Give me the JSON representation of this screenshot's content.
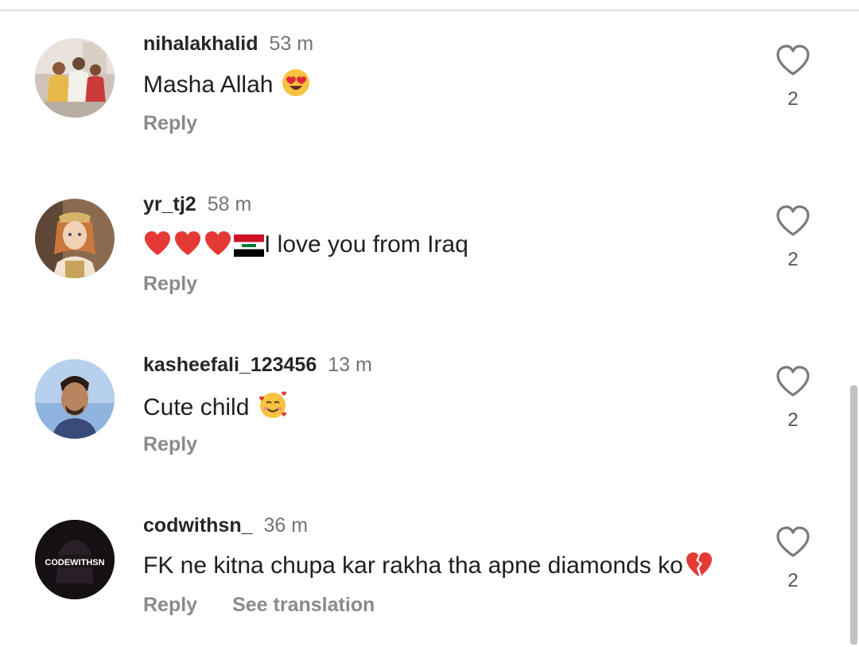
{
  "comments": [
    {
      "username": "nihalakhalid",
      "time": "53 m",
      "text": "Masha Allah ",
      "emoji": [
        "heart-eyes"
      ],
      "reply_label": "Reply",
      "likes": "2",
      "avatar": "family-photo"
    },
    {
      "username": "yr_tj2",
      "time": "58 m",
      "text_prefix_emoji": [
        "red-heart",
        "red-heart",
        "red-heart",
        "iraq-flag"
      ],
      "text": "I love you from Iraq",
      "reply_label": "Reply",
      "likes": "2",
      "avatar": "anime-girl"
    },
    {
      "username": "kasheefali_123456",
      "time": "13 m",
      "text": "Cute child ",
      "emoji": [
        "smiling-face-with-hearts"
      ],
      "reply_label": "Reply",
      "likes": "2",
      "avatar": "man-portrait"
    },
    {
      "username": "codwithsn_",
      "time": "36 m",
      "text": "FK ne kitna chupa kar rakha tha apne diamonds ko",
      "emoji": [
        "broken-heart"
      ],
      "reply_label": "Reply",
      "see_translation_label": "See translation",
      "likes": "2",
      "avatar": "codewithsn-logo",
      "avatar_text": "CODEWITHSN"
    }
  ],
  "colors": {
    "username": "#262626",
    "timestamp": "#737373",
    "reply": "#8a8a8a",
    "heart_outline": "#7a7a7a"
  }
}
